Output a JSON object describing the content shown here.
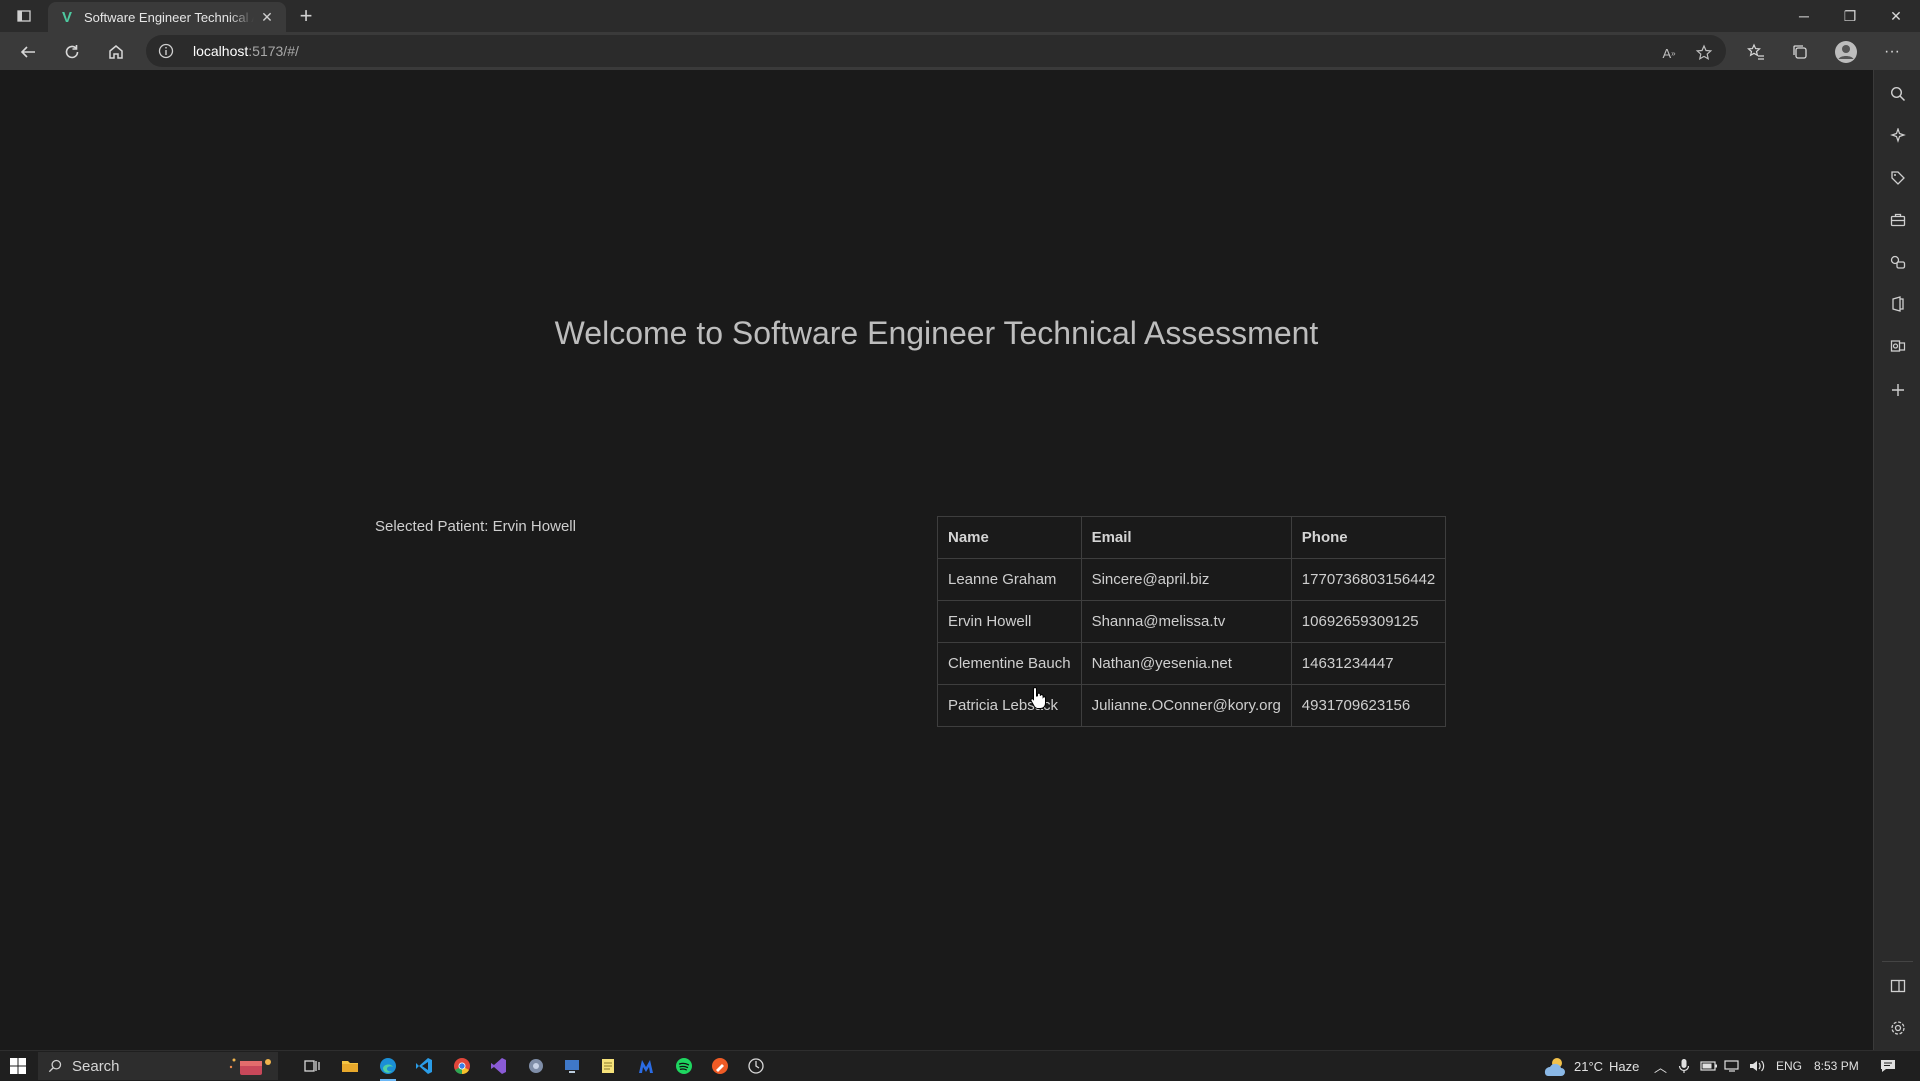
{
  "browser": {
    "tab_title": "Software Engineer Technical Assessment",
    "url_host": "localhost",
    "url_rest": ":5173/#/"
  },
  "page": {
    "heading": "Welcome to Software Engineer Technical Assessment",
    "selected_label": "Selected Patient:",
    "selected_value": "Ervin Howell",
    "table": {
      "headers": [
        "Name",
        "Email",
        "Phone"
      ],
      "rows": [
        [
          "Leanne Graham",
          "Sincere@april.biz",
          "1770736803156442"
        ],
        [
          "Ervin Howell",
          "Shanna@melissa.tv",
          "10692659309125"
        ],
        [
          "Clementine Bauch",
          "Nathan@yesenia.net",
          "14631234447"
        ],
        [
          "Patricia Lebsack",
          "Julianne.OConner@kory.org",
          "4931709623156"
        ]
      ]
    }
  },
  "taskbar": {
    "search_placeholder": "Search",
    "weather": "21°C",
    "weather_desc": "Haze",
    "language": "ENG",
    "time": "8:53 PM"
  },
  "icons": {
    "favicon": "vite-v-icon",
    "accent": "#4ec9a0"
  }
}
